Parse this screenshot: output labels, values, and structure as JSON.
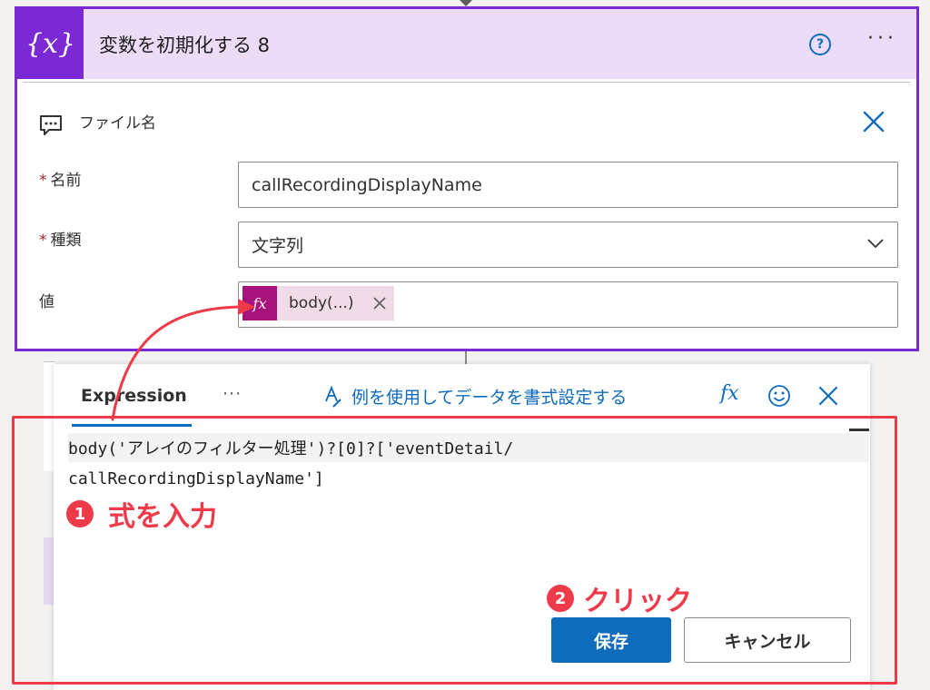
{
  "card": {
    "icon_text": "{x}",
    "title": "変数を初期化する 8",
    "help_glyph": "?",
    "more_glyph": "···",
    "comment": "ファイル名",
    "fields": {
      "name": {
        "required": "*",
        "label": "名前",
        "value": "callRecordingDisplayName"
      },
      "type": {
        "required": "*",
        "label": "種類",
        "value": "文字列"
      },
      "value": {
        "label": "値",
        "token_icon": "fx",
        "token_text": "body(...)"
      }
    }
  },
  "panel": {
    "tab_expression": "Expression",
    "tab_more": "···",
    "format_link": "例を使用してデータを書式設定する",
    "fx_glyph": "fx",
    "code_line1": "body('アレイのフィルター処理')?[0]?['eventDetail/",
    "code_line2": "callRecordingDisplayName']",
    "save_label": "保存",
    "cancel_label": "キャンセル"
  },
  "annotations": {
    "step1_number": "1",
    "step1_text": "式を入力",
    "step2_number": "2",
    "step2_text": "クリック",
    "color": "#ef3a4a"
  },
  "colors": {
    "accent_purple": "#7a29d4",
    "header_bg": "#ecdcf8",
    "token_fx": "#a8127d",
    "primary_blue": "#0f6cbd"
  },
  "icons": [
    "variable-icon",
    "help-icon",
    "more-icon",
    "comment-icon",
    "close-icon",
    "chevron-down-icon",
    "fx-icon",
    "format-icon",
    "emoji-icon"
  ]
}
